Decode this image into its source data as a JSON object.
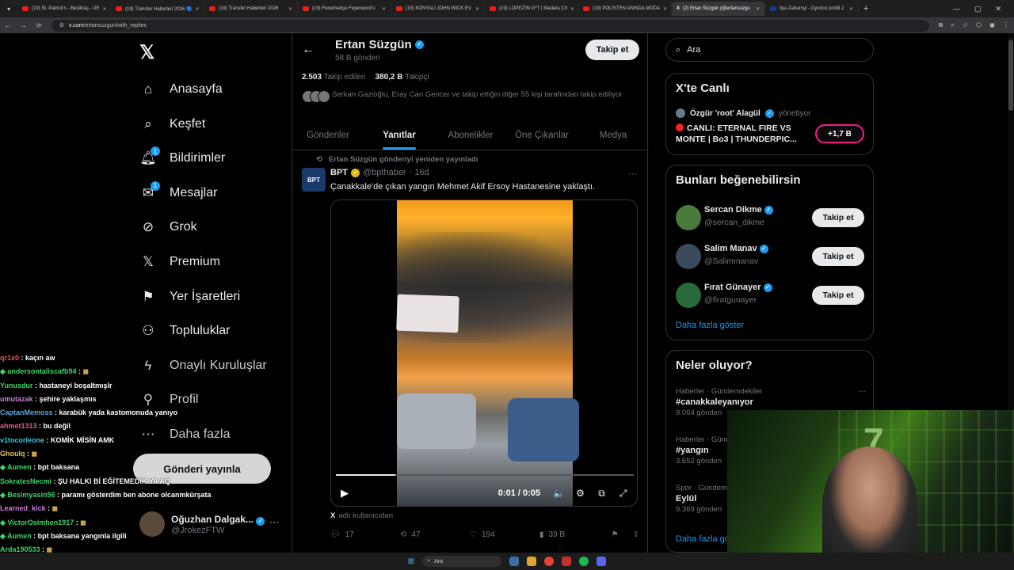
{
  "browser": {
    "tabs": [
      {
        "label": "(19) St. Patrick's - Beşiktaş - UE",
        "favicon": "youtube-icon",
        "active": false
      },
      {
        "label": "(19) Transfer Haberleri 2026 🔵",
        "favicon": "youtube-icon",
        "active": false
      },
      {
        "label": "(19) Transfer Haberleri 2026",
        "favicon": "youtube-icon",
        "active": false
      },
      {
        "label": "(19) Fenerbahçe Feyenoord'u",
        "favicon": "youtube-icon",
        "active": false
      },
      {
        "label": "(19) KONYALI JOHN WICK EV",
        "favicon": "youtube-icon",
        "active": false
      },
      {
        "label": "(19) LOPEZ'İN G*T | Madara Ch",
        "favicon": "youtube-icon",
        "active": false
      },
      {
        "label": "(19) POLİSTEN ANINDA MÜDA",
        "favicon": "youtube-icon",
        "active": false
      },
      {
        "label": "(2) Ertan Süzgün (@ertansuzgu",
        "favicon": "x-icon",
        "active": true
      },
      {
        "label": "Ilya Zabarnyi - Oyuncu profili 2",
        "favicon": "tm-icon",
        "active": false
      }
    ],
    "url_domain": "x.com",
    "url_path": "/ertansuzgun/with_replies"
  },
  "nav": {
    "items": [
      {
        "label": "Anasayfa",
        "icon": "home-icon"
      },
      {
        "label": "Keşfet",
        "icon": "search-icon"
      },
      {
        "label": "Bildirimler",
        "icon": "bell-icon",
        "badge": "1"
      },
      {
        "label": "Mesajlar",
        "icon": "mail-icon",
        "badge": "1"
      },
      {
        "label": "Grok",
        "icon": "grok-icon"
      },
      {
        "label": "Premium",
        "icon": "x-icon"
      },
      {
        "label": "Yer İşaretleri",
        "icon": "bookmark-icon"
      },
      {
        "label": "Topluluklar",
        "icon": "communities-icon"
      },
      {
        "label": "Onaylı Kuruluşlar",
        "icon": "lightning-icon"
      },
      {
        "label": "Profil",
        "icon": "person-icon"
      },
      {
        "label": "Daha fazla",
        "icon": "more-circle-icon"
      }
    ],
    "post_button": "Gönderi yayınla",
    "account": {
      "name": "Oğuzhan Dalgak...",
      "handle": "@JrokezFTW"
    }
  },
  "chat": [
    {
      "user": "qr1x0",
      "text": "kaçın aw",
      "color": "#e05c5c",
      "gem": false
    },
    {
      "user": "andersontaliscafb94",
      "text": "",
      "color": "#3fd36b",
      "gem": true,
      "emote": true
    },
    {
      "user": "Yunusdur",
      "text": "hastaneyi boşaltmışlr",
      "color": "#3fd36b",
      "gem": false
    },
    {
      "user": "umutazak",
      "text": "şehire yaklaşmıs",
      "color": "#c87ee0",
      "gem": false
    },
    {
      "user": "CaptanMemoss",
      "text": "karabük yada kastomonuda yanıyo",
      "color": "#5ba8e0",
      "gem": false
    },
    {
      "user": "ahmet1313",
      "text": "bu değil",
      "color": "#e05c8a",
      "gem": false
    },
    {
      "user": "v1tocorleone",
      "text": "KOMİK MİSİN AMK",
      "color": "#3fc7d3",
      "gem": false
    },
    {
      "user": "Ghoulq",
      "text": "",
      "color": "#e0c05c",
      "gem": false,
      "emote": true
    },
    {
      "user": "Aumen",
      "text": "bpt baksana",
      "color": "#3fd36b",
      "gem": true
    },
    {
      "user": "SokratesNecmi",
      "text": "ŞU HALKI Bİ EĞİTEMEDİK YA AQ",
      "color": "#3fd36b",
      "gem": false
    },
    {
      "user": "Besimyasin56",
      "text": "paramı gösterdim ben abone olcanmkürşata",
      "color": "#3fd36b",
      "gem": true
    },
    {
      "user": "Learned_kick",
      "text": "",
      "color": "#c87ee0",
      "gem": false,
      "emote": true
    },
    {
      "user": "VictorOsimhen1917",
      "text": "",
      "color": "#3fd36b",
      "gem": true,
      "emote": true
    },
    {
      "user": "Aumen",
      "text": "bpt baksana yangınla ilgili",
      "color": "#3fd36b",
      "gem": true
    },
    {
      "user": "Arda190533",
      "text": "",
      "color": "#3fd36b",
      "gem": false,
      "emote": true
    }
  ],
  "profile": {
    "name": "Ertan Süzgün",
    "post_count": "58 B gönderi",
    "follow_button": "Takip et",
    "following_count": "2.503",
    "following_label": "Takip edilen",
    "followers_count": "380,2 B",
    "followers_label": "Takipçi",
    "followers_note": "Serkan Gazioğlu, Eray Can Gencer ve takip ettiğin diğer 55 kişi tarafından takip ediliyor"
  },
  "tabs": [
    {
      "label": "Gönderiler",
      "active": false
    },
    {
      "label": "Yanıtlar",
      "active": true
    },
    {
      "label": "Abonelikler",
      "active": false
    },
    {
      "label": "Öne Çıkanlar",
      "active": false
    },
    {
      "label": "Medya",
      "active": false
    }
  ],
  "tweet": {
    "retweet_label": "Ertan Süzgün gönderiyi yeniden yayınladı",
    "author": "BPT",
    "avatar_text": "BPT",
    "handle": "@bpthaber",
    "time": "· 16d",
    "text": "Çanakkale'de çıkan yangın Mehmet Akif Ersoy Hastanesine yaklaştı.",
    "video_time": "0:01 / 0:05",
    "video_progress": 0.2,
    "source_label": "adlı kullanıcıdan",
    "replies": "17",
    "reposts": "47",
    "likes": "194",
    "views": "39 B"
  },
  "right": {
    "search_placeholder": "Ara",
    "live": {
      "heading": "X'te Canlı",
      "host": "Özgür 'root' Alagül",
      "host_suffix": "yönetiyor",
      "title": "CANLI: ETERNAL FIRE VS MONTE | Bo3 | THUNDERPIC...",
      "count": "+1,7 B"
    },
    "wtf": {
      "heading": "Bunları beğenebilirsin",
      "users": [
        {
          "name": "Sercan Dikme",
          "handle": "@sercan_dikme",
          "button": "Takip et"
        },
        {
          "name": "Salim Manav",
          "handle": "@Salimmanav",
          "button": "Takip et"
        },
        {
          "name": "Fırat Günayer",
          "handle": "@firatgunayer",
          "button": "Takip et"
        }
      ],
      "show_more": "Daha fazla göster"
    },
    "trends": {
      "heading": "Neler oluyor?",
      "items": [
        {
          "category": "Haberler · Gündemdekiler",
          "tag": "#canakkaleyanıyor",
          "count": "9.064 gönderi"
        },
        {
          "category": "Haberler · Günd",
          "tag": "#yangın",
          "count": "3.652 gönderi"
        },
        {
          "category": "Spor · Gündem",
          "tag": "Eylül",
          "count": "9.369 gönderi"
        }
      ],
      "show_more": "Daha fazla gö"
    }
  },
  "taskbar": {
    "search": "Ara"
  },
  "colors": {
    "accent": "#1d9bf0",
    "live_pink": "#f91880",
    "live_red": "#f4212e"
  }
}
